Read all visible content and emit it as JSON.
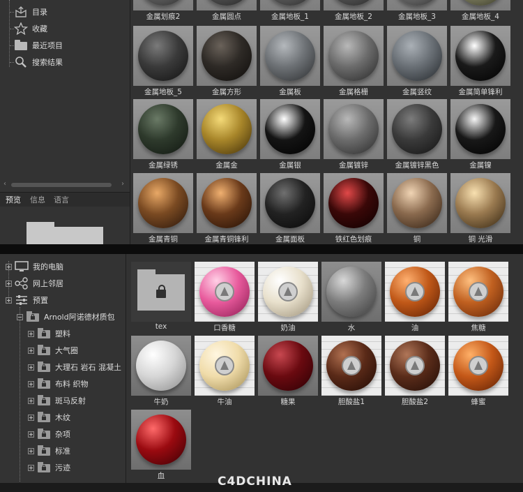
{
  "top_browser": {
    "tree": [
      {
        "label": "目录",
        "icon": "catalog-icon"
      },
      {
        "label": "收藏",
        "icon": "star-icon"
      },
      {
        "label": "最近项目",
        "icon": "folder-icon"
      },
      {
        "label": "搜索结果",
        "icon": "search-icon"
      }
    ],
    "tabs": [
      "预览",
      "信息",
      "语言"
    ],
    "materials": [
      {
        "label": "金属划痕2",
        "base": "#6a6a6a",
        "light": "#a8a8a8",
        "dark": "#2a2a2a"
      },
      {
        "label": "金属圆点",
        "base": "#5a5a5a",
        "light": "#999999",
        "dark": "#202020"
      },
      {
        "label": "金属地板_1",
        "base": "#666666",
        "light": "#b0b0b0",
        "dark": "#262626"
      },
      {
        "label": "金属地板_2",
        "base": "#5c5c5c",
        "light": "#a0a0a0",
        "dark": "#242424"
      },
      {
        "label": "金属地板_3",
        "base": "#787878",
        "light": "#c0c0c0",
        "dark": "#2c2c2c"
      },
      {
        "label": "金属地板_4",
        "base": "#8a8a6a",
        "light": "#c8c8a8",
        "dark": "#303020"
      },
      {
        "label": "金属地板_5",
        "base": "#3a3a3a",
        "light": "#7a7a7a",
        "dark": "#111111"
      },
      {
        "label": "金属方形",
        "base": "#2e2a26",
        "light": "#6a625a",
        "dark": "#0e0c0a"
      },
      {
        "label": "金属板",
        "base": "#6e7276",
        "light": "#b4b8bc",
        "dark": "#2a2c2e"
      },
      {
        "label": "金属格栅",
        "base": "#6c6c6c",
        "light": "#b8b8b8",
        "dark": "#262626"
      },
      {
        "label": "金属竖纹",
        "base": "#6a7076",
        "light": "#aab0b6",
        "dark": "#22262a"
      },
      {
        "label": "金属简单锋利",
        "base": "#1a1a1a",
        "light": "#ffffff",
        "dark": "#000000"
      },
      {
        "label": "金属绿锈",
        "base": "#2e3a2c",
        "light": "#6a7a66",
        "dark": "#101610"
      },
      {
        "label": "金属金",
        "base": "#a8862a",
        "light": "#f4da78",
        "dark": "#3e2c08"
      },
      {
        "label": "金属银",
        "base": "#141414",
        "light": "#ffffff",
        "dark": "#000000"
      },
      {
        "label": "金属镀锌",
        "base": "#6c6c6c",
        "light": "#b8b8b8",
        "dark": "#282828"
      },
      {
        "label": "金属镀锌黑色",
        "base": "#3a3a3a",
        "light": "#7c7c7c",
        "dark": "#121212"
      },
      {
        "label": "金属镍",
        "base": "#181818",
        "light": "#f6f6f6",
        "dark": "#000000"
      },
      {
        "label": "金属青铜",
        "base": "#7a4a22",
        "light": "#e8a866",
        "dark": "#26140a"
      },
      {
        "label": "金属青铜锋利",
        "base": "#6a3a1a",
        "light": "#f0b070",
        "dark": "#200e04"
      },
      {
        "label": "金属面板",
        "base": "#222222",
        "light": "#707070",
        "dark": "#080808"
      },
      {
        "label": "铁红色划痕",
        "base": "#3a0808",
        "light": "#e04848",
        "dark": "#0c0000"
      },
      {
        "label": "铜",
        "base": "#8a6a4e",
        "light": "#f0d4b4",
        "dark": "#2c1c10"
      },
      {
        "label": "铜 光滑",
        "base": "#9a7a50",
        "light": "#f8e0b0",
        "dark": "#30220e"
      }
    ]
  },
  "bottom_browser": {
    "tree": [
      {
        "label": "我的电脑",
        "icon": "computer-icon",
        "level": 0
      },
      {
        "label": "网上邻居",
        "icon": "network-icon",
        "level": 0
      },
      {
        "label": "预置",
        "icon": "presets-icon",
        "level": 0
      },
      {
        "label": "Arnold阿诺德材质包",
        "icon": "locked-folder-icon",
        "level": 1
      },
      {
        "label": "塑料",
        "icon": "locked-folder-icon",
        "level": 2
      },
      {
        "label": "大气圈",
        "icon": "locked-folder-icon",
        "level": 2
      },
      {
        "label": "大理石 岩石 混凝土",
        "icon": "locked-folder-icon",
        "level": 2
      },
      {
        "label": "布料 织物",
        "icon": "locked-folder-icon",
        "level": 2
      },
      {
        "label": "斑马反射",
        "icon": "locked-folder-icon",
        "level": 2
      },
      {
        "label": "木纹",
        "icon": "locked-folder-icon",
        "level": 2
      },
      {
        "label": "杂项",
        "icon": "locked-folder-icon",
        "level": 2
      },
      {
        "label": "标准",
        "icon": "locked-folder-icon",
        "level": 2
      },
      {
        "label": "污迹",
        "icon": "locked-folder-icon",
        "level": 2
      }
    ],
    "materials": [
      {
        "label": "tex",
        "kind": "folder"
      },
      {
        "label": "口香糖",
        "kind": "logo",
        "base": "#e85a9c",
        "light": "#ffd0e6",
        "dark": "#8a1a50"
      },
      {
        "label": "奶油",
        "kind": "logo",
        "base": "#e8e0cc",
        "light": "#ffffff",
        "dark": "#9a8e76"
      },
      {
        "label": "水",
        "kind": "sphere",
        "base": "#7c7c7c",
        "light": "#d8d8d8",
        "dark": "#3a3a3a"
      },
      {
        "label": "油",
        "kind": "logo",
        "base": "#c05818",
        "light": "#ffb070",
        "dark": "#5a1e04"
      },
      {
        "label": "焦糖",
        "kind": "logo",
        "base": "#c06020",
        "light": "#ffc080",
        "dark": "#602408"
      },
      {
        "label": "牛奶",
        "kind": "sphere",
        "base": "#d6d6d6",
        "light": "#ffffff",
        "dark": "#8a8a8a"
      },
      {
        "label": "牛油",
        "kind": "logo",
        "base": "#f0dcaa",
        "light": "#fff6e0",
        "dark": "#a08a50"
      },
      {
        "label": "糖果",
        "kind": "sphere",
        "base": "#6a0a10",
        "light": "#c84850",
        "dark": "#2a0004"
      },
      {
        "label": "胆酸盐1",
        "kind": "logo",
        "base": "#5a2a18",
        "light": "#b07050",
        "dark": "#200a04"
      },
      {
        "label": "胆酸盐2",
        "kind": "logo",
        "base": "#5a2c1a",
        "light": "#b07658",
        "dark": "#200c06"
      },
      {
        "label": "蜂蜜",
        "kind": "logo",
        "base": "#c45818",
        "light": "#ffb068",
        "dark": "#5a1e04"
      },
      {
        "label": "血",
        "kind": "sphere",
        "base": "#9a0a10",
        "light": "#ff6a6a",
        "dark": "#3a0004"
      }
    ]
  },
  "watermark": "C4DCHINA"
}
